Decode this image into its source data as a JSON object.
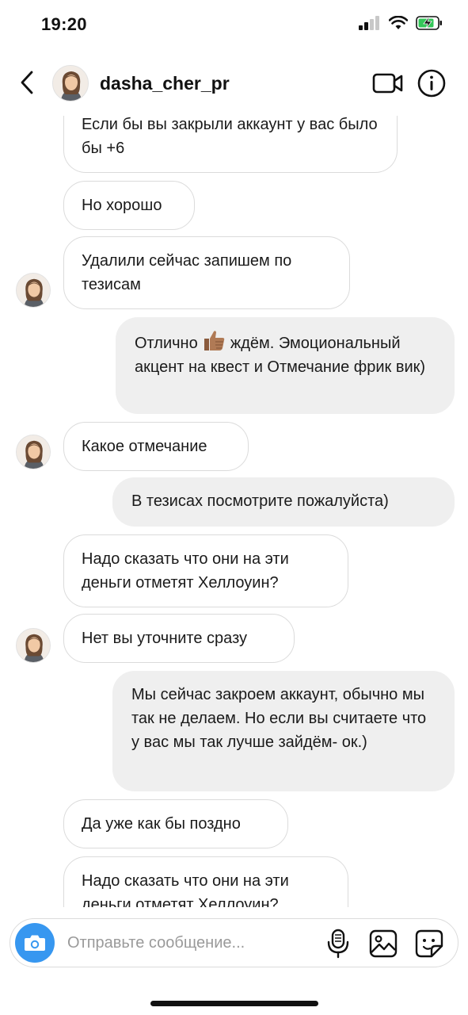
{
  "status_bar": {
    "time": "19:20",
    "signal_icon": "cellular-signal-icon",
    "wifi_icon": "wifi-icon",
    "battery_icon": "battery-charging-icon"
  },
  "header": {
    "username": "dasha_cher_pr",
    "back_icon": "chevron-left-icon",
    "video_icon": "video-camera-icon",
    "info_icon": "info-icon"
  },
  "messages": [
    {
      "from": "them",
      "text": "Если бы вы закрыли аккаунт у вас было бы +6",
      "avatar": false
    },
    {
      "from": "them",
      "text": "Но хорошо",
      "avatar": false
    },
    {
      "from": "them",
      "text": "Удалили сейчас запишем по тезисам",
      "avatar": true
    },
    {
      "from": "me",
      "text_before": "Отлично",
      "emoji": "👍🏽",
      "text_after": "ждём. Эмоциональный акцент на квест и Отмечание фрик вик)"
    },
    {
      "from": "them",
      "text": "Какое отмечание",
      "avatar": true
    },
    {
      "from": "me",
      "text": "В тезисах посмотрите пожалуйста)"
    },
    {
      "from": "them",
      "text": "Надо сказать что они на эти деньги отметят Хеллоуин?",
      "avatar": false
    },
    {
      "from": "them",
      "text": "Нет вы уточните сразу",
      "avatar": true
    },
    {
      "from": "me",
      "text": "Мы сейчас закроем аккаунт, обычно мы так не делаем. Но если вы считаете что у вас мы так лучше зайдём- ок.)"
    },
    {
      "from": "them",
      "text": "Да уже как бы поздно",
      "avatar": false
    },
    {
      "from": "them",
      "text": "Надо сказать что они на эти деньги отметят Хеллоуин?",
      "avatar": false
    }
  ],
  "composer": {
    "placeholder": "Отправьте сообщение...",
    "value": "",
    "camera_icon": "camera-icon",
    "mic_icon": "microphone-icon",
    "gallery_icon": "image-gallery-icon",
    "sticker_icon": "sticker-icon"
  },
  "colors": {
    "accent": "#3797f0",
    "outgoing_bubble": "#efefef",
    "incoming_border": "#dbdbdb"
  }
}
